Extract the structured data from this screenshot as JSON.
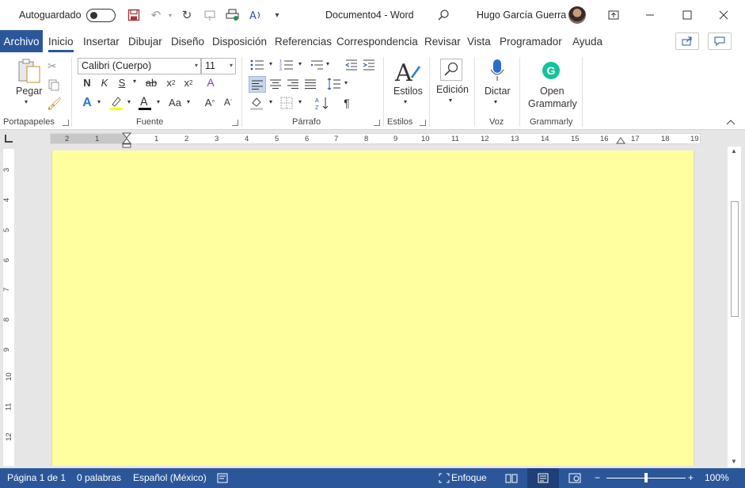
{
  "titlebar": {
    "autosave_label": "Autoguardado",
    "document_title": "Documento4  -  Word",
    "user_name": "Hugo García Guerra"
  },
  "tabs": [
    "Archivo",
    "Inicio",
    "Insertar",
    "Dibujar",
    "Diseño",
    "Disposición",
    "Referencias",
    "Correspondencia",
    "Revisar",
    "Vista",
    "Programador",
    "Ayuda"
  ],
  "ribbon": {
    "clipboard": {
      "paste_label": "Pegar",
      "group_label": "Portapapeles"
    },
    "font": {
      "font_name": "Calibri (Cuerpo)",
      "font_size": "11",
      "bold": "N",
      "italic": "K",
      "underline": "S",
      "strike": "ab",
      "subscript": "x",
      "superscript": "x",
      "change_case": "Aa",
      "grow": "A",
      "shrink": "A",
      "group_label": "Fuente"
    },
    "paragraph": {
      "group_label": "Párrafo",
      "pilcrow": "¶"
    },
    "styles": {
      "label": "Estilos",
      "group_label": "Estilos"
    },
    "editing": {
      "label": "Edición"
    },
    "voice": {
      "label": "Dictar",
      "group_label": "Voz"
    },
    "grammarly": {
      "label_line1": "Open",
      "label_line2": "Grammarly",
      "group_label": "Grammarly"
    }
  },
  "ruler": {
    "h_labels": [
      "2",
      "1",
      "1",
      "2",
      "3",
      "4",
      "5",
      "6",
      "7",
      "8",
      "9",
      "10",
      "11",
      "12",
      "13",
      "14",
      "15",
      "16",
      "17",
      "18",
      "19"
    ],
    "v_labels": [
      "3",
      "4",
      "5",
      "6",
      "7",
      "8",
      "9",
      "10",
      "11",
      "12"
    ]
  },
  "status": {
    "page": "Página 1 de 1",
    "words": "0 palabras",
    "language": "Español (México)",
    "focus": "Enfoque",
    "zoom": "100%"
  },
  "colors": {
    "accent": "#2b579a",
    "page_background": "#ffffa0"
  }
}
